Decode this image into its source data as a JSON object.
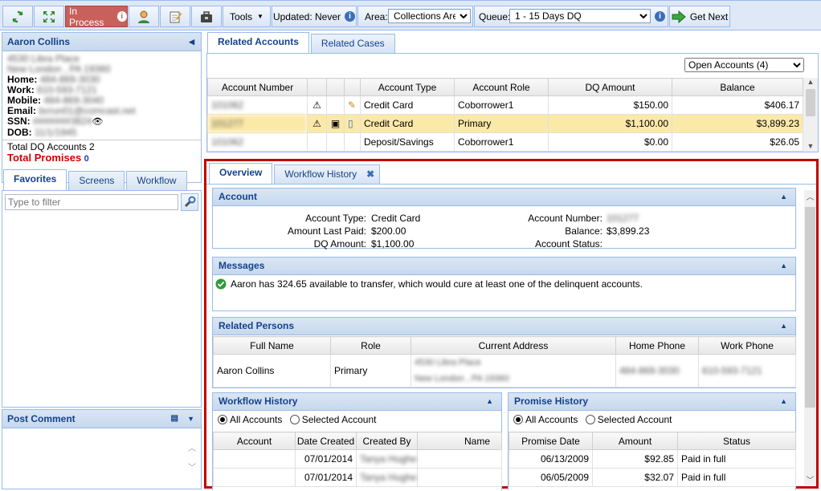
{
  "toolbar": {
    "status": "In Process",
    "tools": "Tools",
    "updated": "Updated: Never",
    "area_label": "Area:",
    "area_value": "Collections Area",
    "queue_label": "Queue:",
    "queue_value": "1 - 15 Days DQ",
    "get_next": "Get Next"
  },
  "customer": {
    "name": "Aaron Collins",
    "address1": "4530 Libra Place",
    "address2": "New London , PA 19360",
    "home_label": "Home:",
    "home": "484-869-3030",
    "work_label": "Work:",
    "work": "610-593-7121",
    "mobile_label": "Mobile:",
    "mobile": "484-869-3040",
    "email_label": "Email:",
    "email": "bcrun01@comcast.net",
    "ssn_label": "SSN:",
    "ssn": "#######3824",
    "dob_label": "DOB:",
    "dob": "11/1/1945",
    "total_dq": "Total DQ Accounts 2",
    "total_promises": "Total Promises",
    "promises_count": "0"
  },
  "left_tabs": [
    "Favorites",
    "Screens",
    "Workflow"
  ],
  "filter_placeholder": "Type to filter",
  "post_comment": "Post Comment",
  "top_tabs": [
    "Related Accounts",
    "Related Cases"
  ],
  "accounts_filter": "Open Accounts (4)",
  "accounts": {
    "headers": [
      "Account Number",
      "Account Type",
      "Account Role",
      "DQ Amount",
      "Balance"
    ],
    "rows": [
      {
        "number": "101062",
        "type": "Credit Card",
        "role": "Coborrower1",
        "dq": "$150.00",
        "balance": "$406.17"
      },
      {
        "number": "101277",
        "type": "Credit Card",
        "role": "Primary",
        "dq": "$1,100.00",
        "balance": "$3,899.23"
      },
      {
        "number": "101062",
        "type": "Deposit/Savings",
        "role": "Coborrower1",
        "dq": "$0.00",
        "balance": "$26.05"
      }
    ]
  },
  "detail_tabs": [
    "Overview",
    "Workflow History"
  ],
  "account_section": {
    "title": "Account",
    "type_label": "Account Type:",
    "type": "Credit Card",
    "last_paid_label": "Amount Last Paid:",
    "last_paid": "$200.00",
    "dq_label": "DQ Amount:",
    "dq": "$1,100.00",
    "number_label": "Account Number:",
    "number": "101277",
    "balance_label": "Balance:",
    "balance": "$3,899.23",
    "status_label": "Account Status:"
  },
  "messages": {
    "title": "Messages",
    "text": "Aaron has 324.65 available to transfer, which would cure at least one of the delinquent accounts."
  },
  "persons": {
    "title": "Related Persons",
    "headers": [
      "Full Name",
      "Role",
      "Current Address",
      "Home Phone",
      "Work Phone"
    ],
    "name": "Aaron Collins",
    "role": "Primary",
    "addr1": "4530 Libra Place",
    "addr2": "New London , PA 19360",
    "home": "484-869-3030",
    "work": "610-593-7121"
  },
  "workflow": {
    "title": "Workflow History",
    "all": "All Accounts",
    "selected": "Selected Account",
    "headers": [
      "Account",
      "Date Created",
      "Created By",
      "Name"
    ],
    "rows": [
      {
        "date": "07/01/2014",
        "by": "Tanya Hughes"
      },
      {
        "date": "07/01/2014",
        "by": "Tanya Hughes"
      }
    ]
  },
  "promise": {
    "title": "Promise History",
    "all": "All Accounts",
    "selected": "Selected Account",
    "headers": [
      "Promise Date",
      "Amount",
      "Status"
    ],
    "rows": [
      {
        "date": "06/13/2009",
        "amount": "$92.85",
        "status": "Paid in full"
      },
      {
        "date": "06/05/2009",
        "amount": "$32.07",
        "status": "Paid in full"
      }
    ]
  },
  "colors": {
    "highlight": "#c00000",
    "status_bg": "#c8605c",
    "header_text": "#15428b",
    "selected_row": "#fbe9a8"
  }
}
